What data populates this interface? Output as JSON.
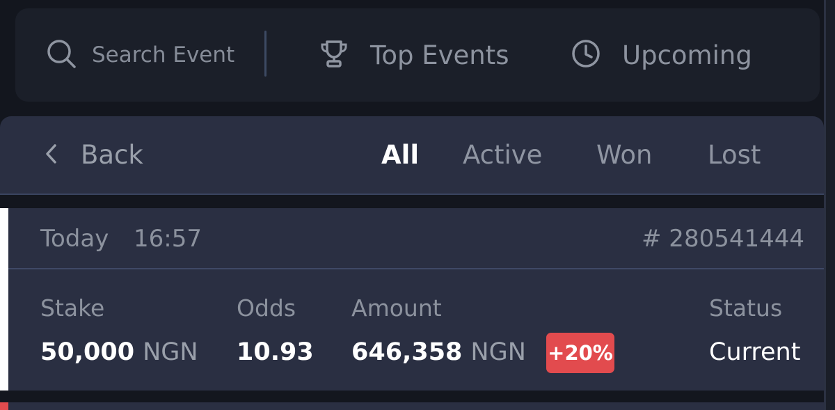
{
  "search": {
    "placeholder": "Search Event",
    "icon": "search-icon"
  },
  "top_nav": {
    "top_events": {
      "label": "Top Events",
      "icon": "trophy-icon"
    },
    "upcoming": {
      "label": "Upcoming",
      "icon": "clock-icon"
    }
  },
  "filter": {
    "back_label": "Back",
    "tabs": [
      {
        "label": "All",
        "active": true
      },
      {
        "label": "Active",
        "active": false
      },
      {
        "label": "Won",
        "active": false
      },
      {
        "label": "Lost",
        "active": false
      }
    ]
  },
  "bet": {
    "date": "Today",
    "time": "16:57",
    "id": "# 280541444",
    "stake_label": "Stake",
    "stake_value": "50,000",
    "stake_currency": "NGN",
    "odds_label": "Odds",
    "odds_value": "10.93",
    "amount_label": "Amount",
    "amount_value": "646,358",
    "amount_currency": "NGN",
    "bonus": "+20%",
    "status_label": "Status",
    "status_value": "Current"
  },
  "colors": {
    "background": "#13161e",
    "panel": "#2a2f42",
    "topbar": "#1b1f29",
    "bonus_badge": "#e24b4e",
    "accent_bar": "#ffffff"
  }
}
